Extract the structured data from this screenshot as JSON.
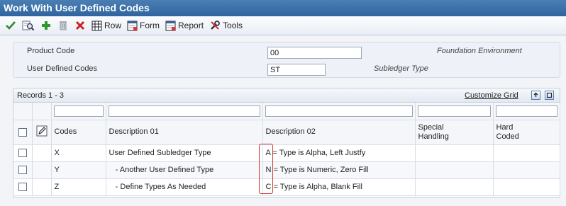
{
  "window": {
    "title": "Work With User Defined Codes"
  },
  "toolbar": {
    "row_label": "Row",
    "form_label": "Form",
    "report_label": "Report",
    "tools_label": "Tools"
  },
  "criteria": {
    "product_code": {
      "label": "Product Code",
      "value": "00",
      "description": "Foundation Environment"
    },
    "user_defined_codes": {
      "label": "User Defined Codes",
      "value": "ST",
      "description": "Subledger Type"
    }
  },
  "grid": {
    "records_label": "Records 1 - 3",
    "customize_label": "Customize Grid",
    "columns": {
      "codes": "Codes",
      "description_01": "Description 01",
      "description_02": "Description 02",
      "special_handling_1": "Special",
      "special_handling_2": "Handling",
      "hard_coded_1": "Hard",
      "hard_coded_2": "Coded"
    },
    "rows": [
      {
        "code": "X",
        "description_01": "User Defined Subledger Type",
        "description_02": "A = Type is Alpha, Left Justfy",
        "special_handling": "",
        "hard_coded": ""
      },
      {
        "code": "Y",
        "description_01": "   - Another User Defined Type",
        "description_02": "N = Type is Numeric, Zero Fill",
        "special_handling": "",
        "hard_coded": ""
      },
      {
        "code": "Z",
        "description_01": "   - Define Types As Needed",
        "description_02": "C = Type is Alpha, Blank Fill",
        "special_handling": "",
        "hard_coded": ""
      }
    ]
  },
  "colors": {
    "title_bar": "#3a6ea8",
    "highlight": "#d23a2e",
    "check_green": "#2e8b2e",
    "delete_red": "#cc2222"
  }
}
